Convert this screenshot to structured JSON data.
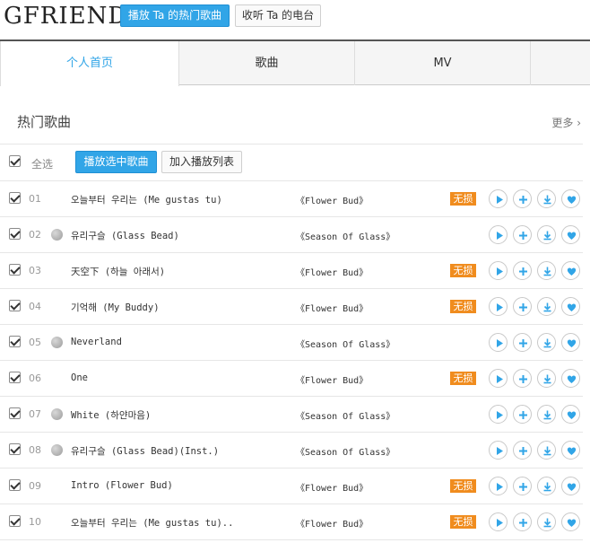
{
  "header": {
    "artist_name": "GFRIEND",
    "play_hot_label": "播放 Ta 的热门歌曲",
    "radio_label": "收听 Ta 的电台"
  },
  "tabs": [
    {
      "label": "个人首页",
      "active": true
    },
    {
      "label": "歌曲",
      "active": false
    },
    {
      "label": "MV",
      "active": false
    },
    {
      "label": "",
      "active": false
    }
  ],
  "section": {
    "title": "热门歌曲",
    "more_label": "更多 ›"
  },
  "toolbar": {
    "select_all_label": "全选",
    "play_selected_label": "播放选中歌曲",
    "add_to_list_label": "加入播放列表"
  },
  "badge_label": "无损",
  "colors": {
    "accent": "#31a5e7",
    "badge": "#f08c1e"
  },
  "songs": [
    {
      "index": "01",
      "title": "오늘부터 우리는 (Me gustas tu)",
      "album": "《Flower Bud》",
      "lossless": true,
      "globe": false,
      "checked": true
    },
    {
      "index": "02",
      "title": "유리구슬 (Glass Bead)",
      "album": "《Season Of Glass》",
      "lossless": false,
      "globe": true,
      "checked": true
    },
    {
      "index": "03",
      "title": "天空下 (하늘 아래서)",
      "album": "《Flower Bud》",
      "lossless": true,
      "globe": false,
      "checked": true
    },
    {
      "index": "04",
      "title": "기억해 (My Buddy)",
      "album": "《Flower Bud》",
      "lossless": true,
      "globe": false,
      "checked": true
    },
    {
      "index": "05",
      "title": "Neverland",
      "album": "《Season Of Glass》",
      "lossless": false,
      "globe": true,
      "checked": true
    },
    {
      "index": "06",
      "title": "One",
      "album": "《Flower Bud》",
      "lossless": true,
      "globe": false,
      "checked": true
    },
    {
      "index": "07",
      "title": "White (하얀마음)",
      "album": "《Season Of Glass》",
      "lossless": false,
      "globe": true,
      "checked": true
    },
    {
      "index": "08",
      "title": "유리구슬 (Glass Bead)(Inst.)",
      "album": "《Season Of Glass》",
      "lossless": false,
      "globe": true,
      "checked": true
    },
    {
      "index": "09",
      "title": "Intro (Flower Bud)",
      "album": "《Flower Bud》",
      "lossless": true,
      "globe": false,
      "checked": true
    },
    {
      "index": "10",
      "title": "오늘부터 우리는 (Me gustas tu)..",
      "album": "《Flower Bud》",
      "lossless": true,
      "globe": false,
      "checked": true
    }
  ]
}
